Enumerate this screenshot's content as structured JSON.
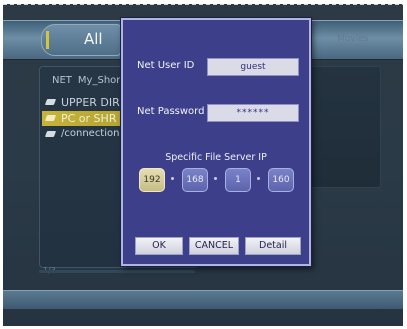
{
  "header": {
    "tab_label": "All",
    "right_label": "Movies"
  },
  "browser": {
    "breadcrumb": {
      "root": "NET",
      "current": "My_Shortc"
    },
    "items": [
      {
        "label": "UPPER DIR",
        "icon": "folder-up-icon",
        "selected": false
      },
      {
        "label": "PC or SHR",
        "icon": "network-folder-icon",
        "selected": true
      },
      {
        "label": "/connection",
        "icon": "folder-icon",
        "selected": false
      }
    ],
    "page_counter": "1/3"
  },
  "dialog": {
    "user_label": "Net User ID",
    "user_value": "guest",
    "password_label": "Net Password",
    "password_value": "******",
    "ip_caption": "Specific File Server IP",
    "ip_octets": [
      "192",
      "168",
      "1",
      "160"
    ],
    "active_octet": 0,
    "buttons": {
      "ok": "OK",
      "cancel": "CANCEL",
      "detail": "Detail"
    }
  },
  "colors": {
    "dialog_bg": "#3d3f8a",
    "selection": "#c7b43a",
    "background": "#2a3a46"
  }
}
